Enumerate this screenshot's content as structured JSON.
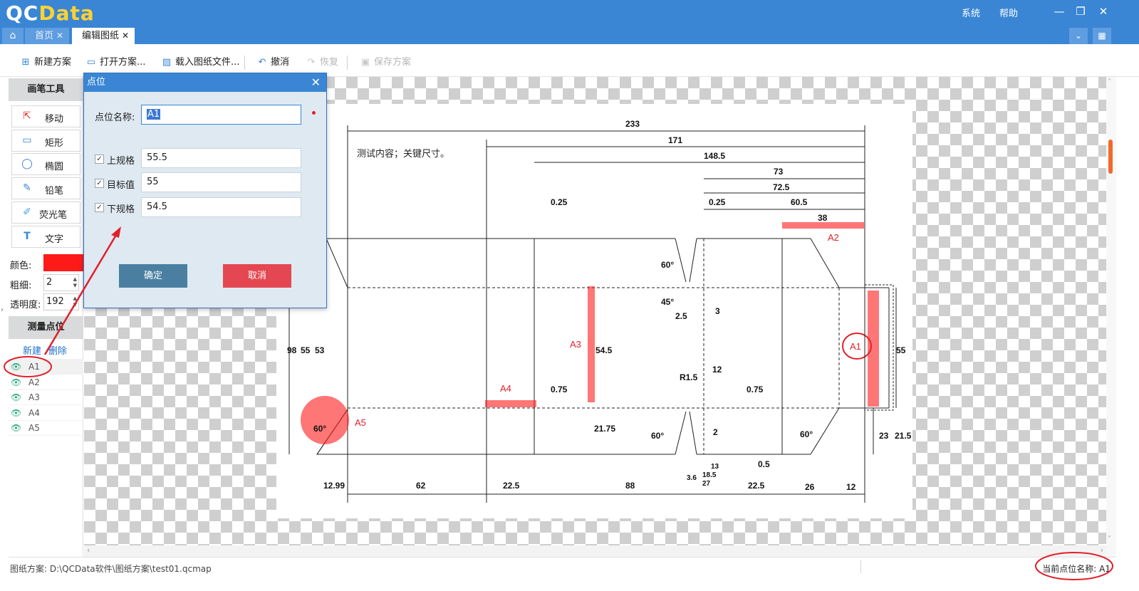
{
  "app": {
    "logo_main": "QC",
    "logo_accent": "Data"
  },
  "title_menu": {
    "system": "系统",
    "help": "帮助"
  },
  "tabs": [
    {
      "label": "首页"
    },
    {
      "label": "编辑图纸"
    }
  ],
  "toolbar": {
    "new_plan": "新建方案",
    "open_plan": "打开方案...",
    "load_file": "载入图纸文件...",
    "undo": "撤消",
    "redo": "恢复",
    "save_plan": "保存方案"
  },
  "left_panel": {
    "pen_tools_header": "画笔工具",
    "tools": [
      {
        "label": "移动",
        "icon": "move-icon"
      },
      {
        "label": "矩形",
        "icon": "rectangle-icon"
      },
      {
        "label": "椭圆",
        "icon": "ellipse-icon"
      },
      {
        "label": "铅笔",
        "icon": "pencil-icon"
      },
      {
        "label": "荧光笔",
        "icon": "highlighter-icon"
      },
      {
        "label": "文字",
        "icon": "text-icon"
      }
    ],
    "color_label": "颜色:",
    "color_value": "#ff1a1a",
    "width_label": "粗细:",
    "width_value": "2",
    "opacity_label": "透明度:",
    "opacity_value": "192",
    "points_header": "测量点位",
    "new_link": "新建",
    "delete_link": "删除",
    "points": [
      "A1",
      "A2",
      "A3",
      "A4",
      "A5"
    ],
    "selected_point": "A1"
  },
  "drawing": {
    "note": "测试内容；关键尺寸。",
    "dims_top": [
      "233",
      "171",
      "148.5",
      "73",
      "72.5",
      "60.5",
      "38",
      "0.25",
      "0.25"
    ],
    "dims_bottom": [
      "12.99",
      "62",
      "22.5",
      "88",
      "13",
      "18.5",
      "27",
      "22.5",
      "26",
      "12",
      "0.5",
      "3.6"
    ],
    "dims_vertical": [
      "98",
      "55",
      "53",
      "54.5",
      "21.75",
      "55",
      "23",
      "21.5",
      "3",
      "2"
    ],
    "dims_misc": [
      "0.75",
      "0.75",
      "12",
      "2.5",
      "R1.5",
      "60°",
      "45°",
      "60°",
      "60°",
      "60°"
    ],
    "markers": [
      "A1",
      "A2",
      "A3",
      "A4",
      "A5"
    ]
  },
  "dialog": {
    "title": "点位",
    "name_label": "点位名称:",
    "name_value": "A1",
    "upper_label": "上规格",
    "upper_value": "55.5",
    "target_label": "目标值",
    "target_value": "55",
    "lower_label": "下规格",
    "lower_value": "54.5",
    "ok_label": "确定",
    "cancel_label": "取消"
  },
  "statusbar": {
    "plan_path": "图纸方案: D:\\QCData软件\\图纸方案\\test01.qcmap",
    "current_point": "当前点位名称: A1"
  },
  "colors": {
    "accent": "#3a86d4",
    "marker": "#ff1a1a",
    "cancel": "#e54752",
    "ok": "#4a7fa2"
  }
}
